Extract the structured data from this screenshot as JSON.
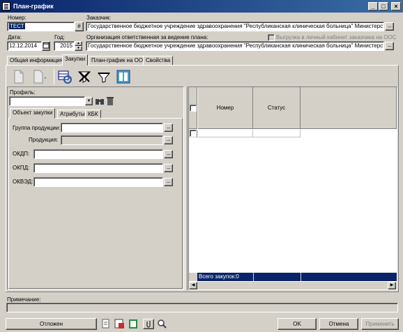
{
  "window": {
    "title": "План-график"
  },
  "header": {
    "number_label": "Номер:",
    "number_value": "ТЕСТ",
    "number_btn": "#",
    "date_label": "Дата:",
    "date_value": "12.12.2014",
    "year_label": "Год:",
    "year_value": "2015",
    "customer_label": "Заказчик:",
    "customer_value": "Государственное бюджетное учреждение здравоохранения \"Республиканская клиническая больница\" Министерства здра",
    "org_label": "Организация ответственная за ведение плана:",
    "org_value": "Государственное бюджетное учреждение здравоохранения \"Республиканская клиническая больница\" Министерства здра",
    "upload_label": "Выгрузка в личный кабинет заказчика на ООС",
    "ellipsis": "..."
  },
  "tabs": [
    {
      "label": "Общая информация"
    },
    {
      "label": "Закупки"
    },
    {
      "label": "План-график на ООС"
    },
    {
      "label": "Свойства"
    }
  ],
  "left": {
    "profile_label": "Профиль:",
    "subtabs": [
      {
        "label": "Объект закупки"
      },
      {
        "label": "Атрибуты"
      },
      {
        "label": "КБК"
      }
    ],
    "fields": {
      "group_label": "Группа продукции:",
      "product_label": "Продукция:",
      "okdp_label": "ОКДП:",
      "okpd_label": "ОКПД:",
      "okved_label": "ОКВЭД:"
    }
  },
  "grid": {
    "col_number": "Номер",
    "col_status": "Статус",
    "footer": "Всего закупок:0"
  },
  "note_label": "Примечание:",
  "bottom": {
    "status_btn": "Отложен",
    "ok": "OK",
    "cancel": "Отмена",
    "apply": "Применить"
  },
  "colors": {
    "titlebar_start": "#0a246a",
    "titlebar_end": "#3a6ea5",
    "face": "#d4d0c8",
    "grid_header": "#0a246a"
  }
}
